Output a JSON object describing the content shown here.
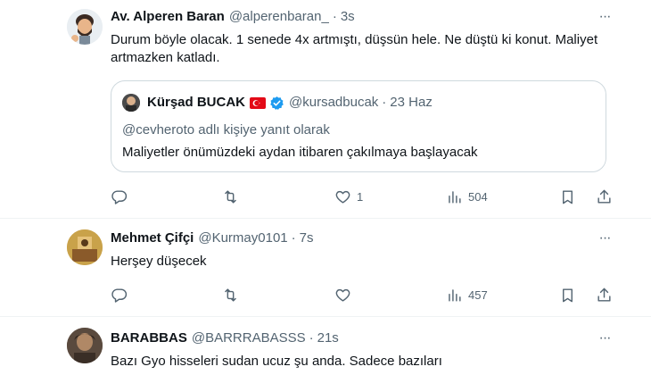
{
  "tweets": [
    {
      "name": "Av. Alperen Baran",
      "handle": "@alperenbaran_",
      "separator": "·",
      "time": "3s",
      "text": "Durum böyle olacak. 1 senede 4x artmıştı, düşsün hele. Ne düştü ki konut. Maliyet artmazken katladı.",
      "quote": {
        "name": "Kürşad BUCAK",
        "handle": "@kursadbucak",
        "separator": "·",
        "time": "23 Haz",
        "reply_context": "@cevheroto adlı kişiye yanıt olarak",
        "text": "Maliyetler önümüzdeki aydan itibaren çakılmaya başlayacak"
      },
      "replies": "",
      "retweets": "",
      "likes": "1",
      "views": "504"
    },
    {
      "name": "Mehmet Çifçi",
      "handle": "@Kurmay0101",
      "separator": "·",
      "time": "7s",
      "text": "Herşey düşecek",
      "replies": "",
      "retweets": "",
      "likes": "",
      "views": "457"
    },
    {
      "name": "BARABBAS",
      "handle": "@BARRRABASSS",
      "separator": "·",
      "time": "21s",
      "text": "Bazı Gyo hisseleri sudan ucuz şu anda. Sadece bazıları"
    }
  ],
  "more_icon": "···"
}
